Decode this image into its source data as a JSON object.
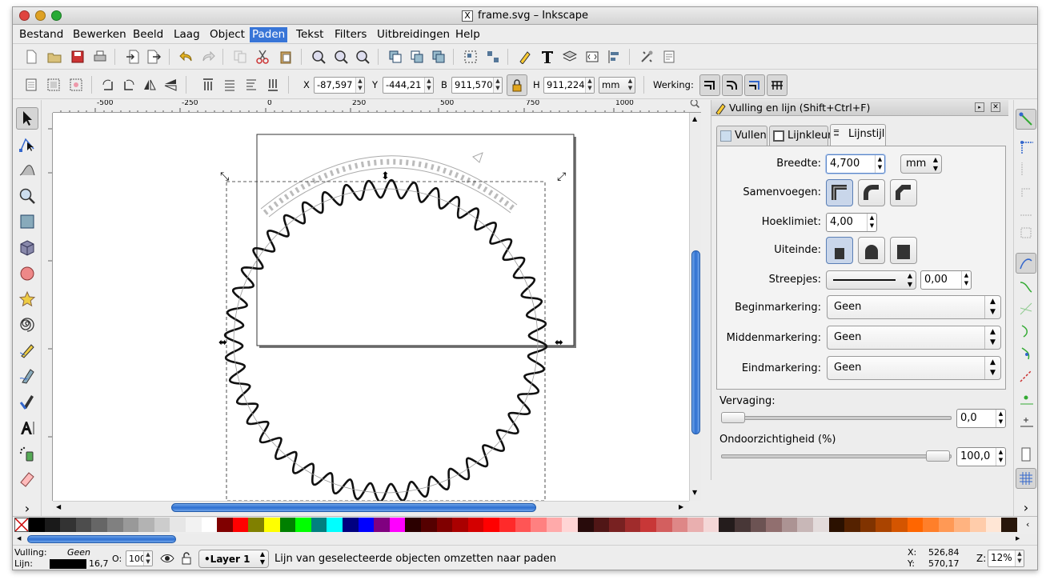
{
  "window": {
    "title": "frame.svg – Inkscape"
  },
  "menu": [
    {
      "label": "Bestand"
    },
    {
      "label": "Bewerken"
    },
    {
      "label": "Beeld"
    },
    {
      "label": "Laag"
    },
    {
      "label": "Object"
    },
    {
      "label": "Paden",
      "active": true
    },
    {
      "label": "Tekst"
    },
    {
      "label": "Filters"
    },
    {
      "label": "Uitbreidingen"
    },
    {
      "label": "Help"
    }
  ],
  "controls": {
    "x_label": "X",
    "x_value": "-87,597",
    "y_label": "Y",
    "y_value": "-444,21",
    "b_label": "B",
    "b_value": "911,570",
    "h_label": "H",
    "h_value": "911,224",
    "unit": "mm",
    "werking_label": "Werking:"
  },
  "ruler": {
    "h_ticks": [
      "-500",
      "-250",
      "0",
      "250",
      "500",
      "750",
      "1000"
    ]
  },
  "dialog": {
    "title": "Vulling en lijn (Shift+Ctrl+F)",
    "tabs": [
      {
        "label": "Vullen"
      },
      {
        "label": "Lijnkleur"
      },
      {
        "label": "Lijnstijl",
        "active": true
      }
    ],
    "width_label": "Breedte:",
    "width_value": "4,700",
    "width_unit": "mm",
    "join_label": "Samenvoegen:",
    "miter_label": "Hoeklimiet:",
    "miter_value": "4,00",
    "cap_label": "Uiteinde:",
    "dash_label": "Streepjes:",
    "dash_offset": "0,00",
    "start_marker_label": "Beginmarkering:",
    "start_marker": "Geen",
    "mid_marker_label": "Middenmarkering:",
    "mid_marker": "Geen",
    "end_marker_label": "Eindmarkering:",
    "end_marker": "Geen",
    "blur_label": "Vervaging:",
    "blur_value": "0,0",
    "opacity_label": "Ondoorzichtigheid (%)",
    "opacity_value": "100,0"
  },
  "status": {
    "fill_label": "Vulling:",
    "fill_value": "Geen",
    "stroke_label": "Lijn:",
    "stroke_width": "16,7",
    "opacity_label": "O:",
    "opacity_value": "100",
    "layer": "•Layer 1",
    "message": "Lijn van geselecteerde objecten omzetten naar paden",
    "x_label": "X:",
    "x": "526,84",
    "y_label": "Y:",
    "y": "570,17",
    "zoom_label": "Z:",
    "zoom": "12%"
  },
  "palette": [
    "#000000",
    "#1a1a1a",
    "#333333",
    "#4d4d4d",
    "#666666",
    "#808080",
    "#999999",
    "#b3b3b3",
    "#cccccc",
    "#e6e6e6",
    "#f2f2f2",
    "#ffffff",
    "#800000",
    "#ff0000",
    "#808000",
    "#ffff00",
    "#008000",
    "#00ff00",
    "#008080",
    "#00ffff",
    "#000080",
    "#0000ff",
    "#800080",
    "#ff00ff",
    "#2b0000",
    "#550000",
    "#800000",
    "#aa0000",
    "#d40000",
    "#ff0000",
    "#ff2a2a",
    "#ff5555",
    "#ff8080",
    "#ffaaaa",
    "#ffd5d5",
    "#280b0b",
    "#501616",
    "#782121",
    "#a02c2c",
    "#c83737",
    "#d35f5f",
    "#de8787",
    "#e9afaf",
    "#f4d7d7",
    "#241c1c",
    "#483737",
    "#6c5353",
    "#916f6f",
    "#ac9393",
    "#c8b7b7",
    "#e3dbdb",
    "#2b1100",
    "#552200",
    "#803300",
    "#aa4400",
    "#d45500",
    "#ff6600",
    "#ff7f2a",
    "#ff9955",
    "#ffb380",
    "#ffccaa",
    "#ffe6d5",
    "#28170b"
  ]
}
